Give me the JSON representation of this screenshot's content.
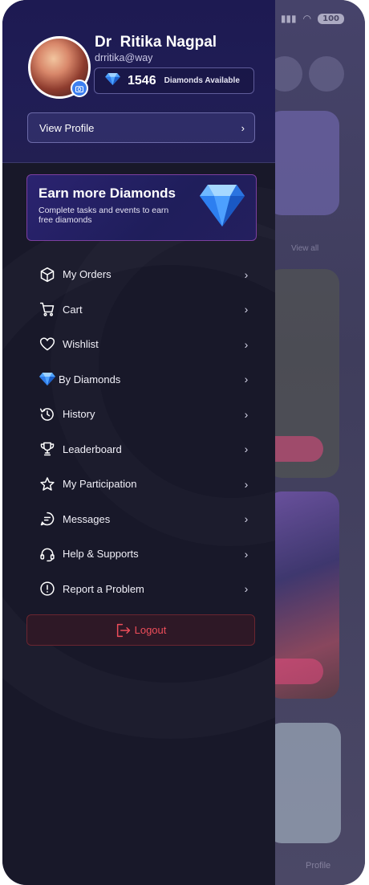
{
  "status_bar": {
    "battery": "100"
  },
  "background_app": {
    "view_all": "View all",
    "profile_tab": "Profile"
  },
  "drawer": {
    "user": {
      "name": "Dr  Ritika Nagpal",
      "email": "drritika@way",
      "diamonds": "1546",
      "diamonds_label": "Diamonds Available"
    },
    "view_profile": "View Profile",
    "earn_card": {
      "title": "Earn more Diamonds",
      "subtitle": "Complete tasks and events to earn free diamonds"
    },
    "menu": [
      {
        "label": "My Orders",
        "icon": "box-icon"
      },
      {
        "label": "Cart",
        "icon": "cart-icon"
      },
      {
        "label": "Wishlist",
        "icon": "heart-icon"
      },
      {
        "label": "By Diamonds",
        "icon": "diamond-icon"
      },
      {
        "label": "History",
        "icon": "history-icon"
      },
      {
        "label": "Leaderboard",
        "icon": "trophy-icon"
      },
      {
        "label": "My Participation",
        "icon": "star-icon"
      },
      {
        "label": "Messages",
        "icon": "message-icon"
      },
      {
        "label": "Help & Supports",
        "icon": "headset-icon"
      },
      {
        "label": "Report a Problem",
        "icon": "alert-icon"
      }
    ],
    "logout": "Logout"
  },
  "colors": {
    "drawer_bg": "#181829",
    "header_bg": "#1d1a52",
    "accent_blue": "#3d7ff0",
    "logout_red": "#ee4d5a"
  }
}
